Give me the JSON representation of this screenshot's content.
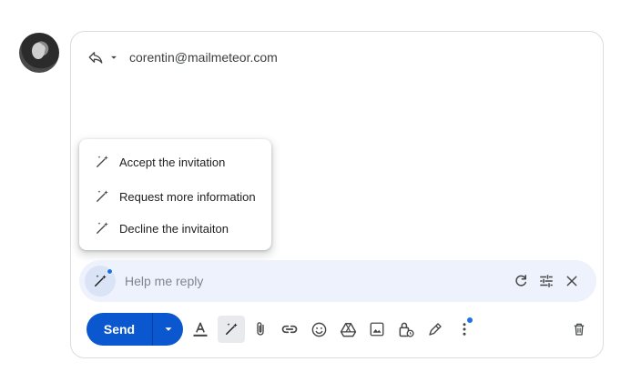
{
  "header": {
    "to_address": "corentin@mailmeteor.com"
  },
  "suggestions": [
    {
      "label": "Accept the invitation"
    },
    {
      "label": "Request more information"
    },
    {
      "label": "Decline the invitaiton"
    }
  ],
  "help_me_reply": {
    "placeholder": "Help me reply",
    "value": ""
  },
  "toolbar": {
    "send_label": "Send"
  },
  "icons": {
    "reply": "reply-arrow-icon",
    "sparkle": "magic-wand-sparkle-icon",
    "refresh": "refresh-icon",
    "tune": "tune-sliders-icon",
    "close": "close-icon"
  },
  "colors": {
    "send_blue": "#0b57d0",
    "help_bar_bg": "#eef2fc",
    "notification_dot": "#1a73e8"
  }
}
